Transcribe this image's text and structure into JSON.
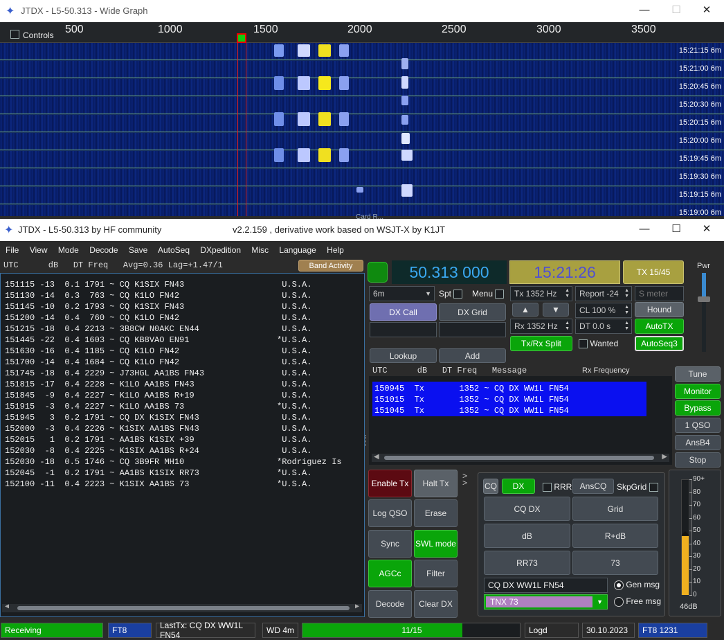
{
  "wide_graph": {
    "title": "JTDX - L5-50.313 - Wide Graph",
    "controls_label": "Controls",
    "freq_ticks": [
      "500",
      "1000",
      "1500",
      "2000",
      "2500",
      "3000",
      "3500"
    ],
    "timestamps": [
      "15:21:15",
      "15:21:00",
      "15:20:45",
      "15:20:30",
      "15:20:15",
      "15:20:00",
      "15:19:45",
      "15:19:30",
      "15:19:15",
      "15:19:00"
    ],
    "band_label": "6m",
    "footer_text": "Card R..."
  },
  "main_window": {
    "title_left": "JTDX - L5-50.313  by HF community",
    "title_center": "v2.2.159 , derivative work based on WSJT-X by K1JT"
  },
  "menu": [
    "File",
    "View",
    "Mode",
    "Decode",
    "Save",
    "AutoSeq",
    "DXpedition",
    "Misc",
    "Language",
    "Help"
  ],
  "band_activity": {
    "header": "UTC      dB   DT Freq   Avg=0.36 Lag=+1.47/1",
    "button": "Band Activity",
    "lines": [
      {
        "text": "151115 -13  0.1 1791 ~ CQ K1SIX FN43",
        "country": " U.S.A."
      },
      {
        "text": "151130 -14  0.3  763 ~ CQ K1LO FN42",
        "country": " U.S.A."
      },
      {
        "text": "151145 -10  0.2 1793 ~ CQ K1SIX FN43",
        "country": " U.S.A."
      },
      {
        "text": "151200 -14  0.4  760 ~ CQ K1LO FN42",
        "country": " U.S.A."
      },
      {
        "text": "151215 -18  0.4 2213 ~ 3B8CW N0AKC EN44",
        "country": " U.S.A."
      },
      {
        "text": "151445 -22  0.4 1603 ~ CQ KB8VAO EN91",
        "country": "*U.S.A."
      },
      {
        "text": "151630 -16  0.4 1185 ~ CQ K1LO FN42",
        "country": " U.S.A."
      },
      {
        "text": "151700 -14  0.4 1684 ~ CQ K1LO FN42",
        "country": " U.S.A."
      },
      {
        "text": "151745 -18  0.4 2229 ~ J73HGL AA1BS FN43",
        "country": " U.S.A."
      },
      {
        "text": "151815 -17  0.4 2228 ~ K1LO AA1BS FN43",
        "country": " U.S.A."
      },
      {
        "text": "151845  -9  0.4 2227 ~ K1LO AA1BS R+19",
        "country": " U.S.A."
      },
      {
        "text": "151915  -3  0.4 2227 ~ K1LO AA1BS 73",
        "country": "*U.S.A."
      },
      {
        "text": "151945   3  0.2 1791 ~ CQ DX K1SIX FN43",
        "country": " U.S.A."
      },
      {
        "text": "152000  -3  0.4 2226 ~ K1SIX AA1BS FN43",
        "country": " U.S.A."
      },
      {
        "text": "152015   1  0.2 1791 ~ AA1BS K1SIX +39",
        "country": " U.S.A."
      },
      {
        "text": "152030  -8  0.4 2225 ~ K1SIX AA1BS R+24",
        "country": " U.S.A."
      },
      {
        "text": "152030 -18  0.5 1746 ~ CQ 3B9FR MH10",
        "country": "*Rodriguez Is"
      },
      {
        "text": "152045  -1  0.2 1791 ~ AA1BS K1SIX RR73",
        "country": "*U.S.A."
      },
      {
        "text": "152100 -11  0.4 2223 ~ K1SIX AA1BS 73",
        "country": "*U.S.A."
      }
    ]
  },
  "dial": {
    "frequency": "50.313 000",
    "time": "15:21:26",
    "tx_period": "TX 15/45",
    "pwr_label": "Pwr"
  },
  "controls": {
    "band": "6m",
    "spt": "Spt",
    "menu": "Menu",
    "dx_call": "DX Call",
    "dx_grid": "DX Grid",
    "lookup": "Lookup",
    "add": "Add",
    "tx_freq": "Tx  1352  Hz",
    "rx_freq": "Rx  1352  Hz",
    "report": "Report -24",
    "s_meter_placeholder": "S meter",
    "cl": "CL  100 %",
    "dt": "DT 0.0 s",
    "hound": "Hound",
    "autotx": "AutoTX",
    "autoseq3": "AutoSeq3",
    "split": "Tx/Rx Split",
    "wanted": "Wanted",
    "up": "▲",
    "down": "▼"
  },
  "rx_panel": {
    "header": "UTC      dB   DT Freq   Message",
    "rx_freq_label": "Rx Frequency",
    "tx_lines": [
      "150945  Tx       1352 ~ CQ DX WW1L FN54",
      "151015  Tx       1352 ~ CQ DX WW1L FN54",
      "151045  Tx       1352 ~ CQ DX WW1L FN54"
    ]
  },
  "right_buttons": [
    "Tune",
    "Monitor",
    "Bypass",
    "1 QSO",
    "AnsB4",
    "Stop"
  ],
  "action_buttons": {
    "enable_tx": "Enable Tx",
    "halt_tx": "Halt Tx",
    "log_qso": "Log QSO",
    "erase": "Erase",
    "sync": "Sync",
    "swl_mode": "SWL mode",
    "agcc": "AGCc",
    "filter": "Filter",
    "decode": "Decode",
    "clear_dx": "Clear DX"
  },
  "msg_panel": {
    "cq": "CQ",
    "dx": "DX",
    "rrr": "RRR",
    "anscq": "AnsCQ",
    "skpgrid": "SkpGrid",
    "buttons": [
      "CQ DX",
      "Grid",
      "dB",
      "R+dB",
      "RR73",
      "73"
    ],
    "gen_msg_text": "CQ DX WW1L FN54",
    "free_msg_text": "TNX 73",
    "gen_msg": "Gen msg",
    "free_msg": "Free msg"
  },
  "meter": {
    "scale": [
      "90+",
      "80",
      "70",
      "60",
      "50",
      "40",
      "30",
      "20",
      "10",
      "0"
    ],
    "value_label": "46dB",
    "level_db": 46
  },
  "status_bar": {
    "receiving": "Receiving",
    "mode": "FT8",
    "last_tx": "LastTx: CQ DX WW1L FN54",
    "wd": "WD 4m",
    "progress_text": "11/15",
    "progress_fraction": 0.73,
    "logd": "Logd",
    "date": "30.10.2023",
    "mode_freq": "FT8  1231"
  },
  "colors": {
    "accent_green": "#0aa50a",
    "tx_blue": "#0a10f0",
    "freq_cyan": "#3aa8f0",
    "time_gold": "#a8a040"
  }
}
